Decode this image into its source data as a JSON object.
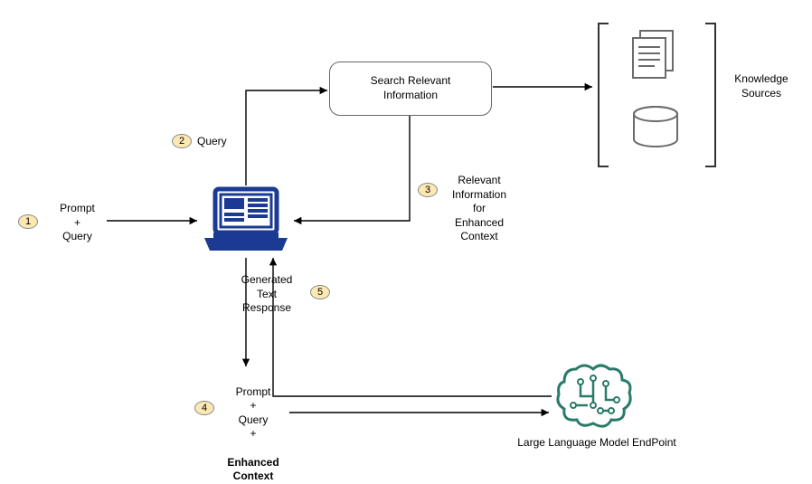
{
  "steps": {
    "s1": "1",
    "s2": "2",
    "s3": "3",
    "s4": "4",
    "s5": "5"
  },
  "labels": {
    "prompt_query": "Prompt\n+\nQuery",
    "query": "Query",
    "search_box": "Search Relevant\nInformation",
    "relevant_info": "Relevant\nInformation\nfor\nEnhanced\nContext",
    "generated": "Generated\nText\nResponse",
    "prompt_query_enhanced_pre": "Prompt\n+\nQuery\n+",
    "prompt_query_enhanced_bold": "Enhanced\nContext",
    "knowledge_sources": "Knowledge\nSources",
    "llm_endpoint": "Large Language Model EndPoint"
  }
}
